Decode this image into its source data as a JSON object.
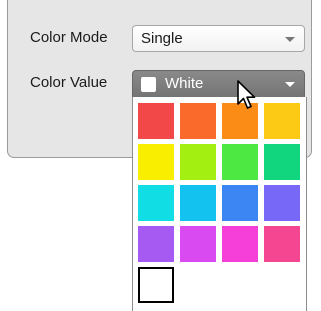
{
  "settings": {
    "color_mode": {
      "label": "Color Mode",
      "value": "Single"
    },
    "color_value": {
      "label": "Color Value",
      "value": "White"
    }
  },
  "palette": {
    "swatches": [
      {
        "name": "red",
        "color": "#f34848"
      },
      {
        "name": "orange-red",
        "color": "#fa6a2a"
      },
      {
        "name": "orange",
        "color": "#fb8d17"
      },
      {
        "name": "yellow-orange",
        "color": "#fcc915"
      },
      {
        "name": "yellow",
        "color": "#f9ee00"
      },
      {
        "name": "yellow-green",
        "color": "#a4ef12"
      },
      {
        "name": "green",
        "color": "#4de842"
      },
      {
        "name": "teal-green",
        "color": "#12d67e"
      },
      {
        "name": "cyan",
        "color": "#11dde4"
      },
      {
        "name": "sky-blue",
        "color": "#14c2ef"
      },
      {
        "name": "blue",
        "color": "#3c86f4"
      },
      {
        "name": "indigo",
        "color": "#7868f8"
      },
      {
        "name": "violet",
        "color": "#a75af2"
      },
      {
        "name": "purple",
        "color": "#d94af0"
      },
      {
        "name": "magenta",
        "color": "#f63fd9"
      },
      {
        "name": "pink",
        "color": "#f44691"
      },
      {
        "name": "white",
        "color": "#ffffff",
        "selected": true
      }
    ]
  },
  "icons": {
    "cursor": "mouse-pointer-icon",
    "chevron": "chevron-down-icon"
  }
}
